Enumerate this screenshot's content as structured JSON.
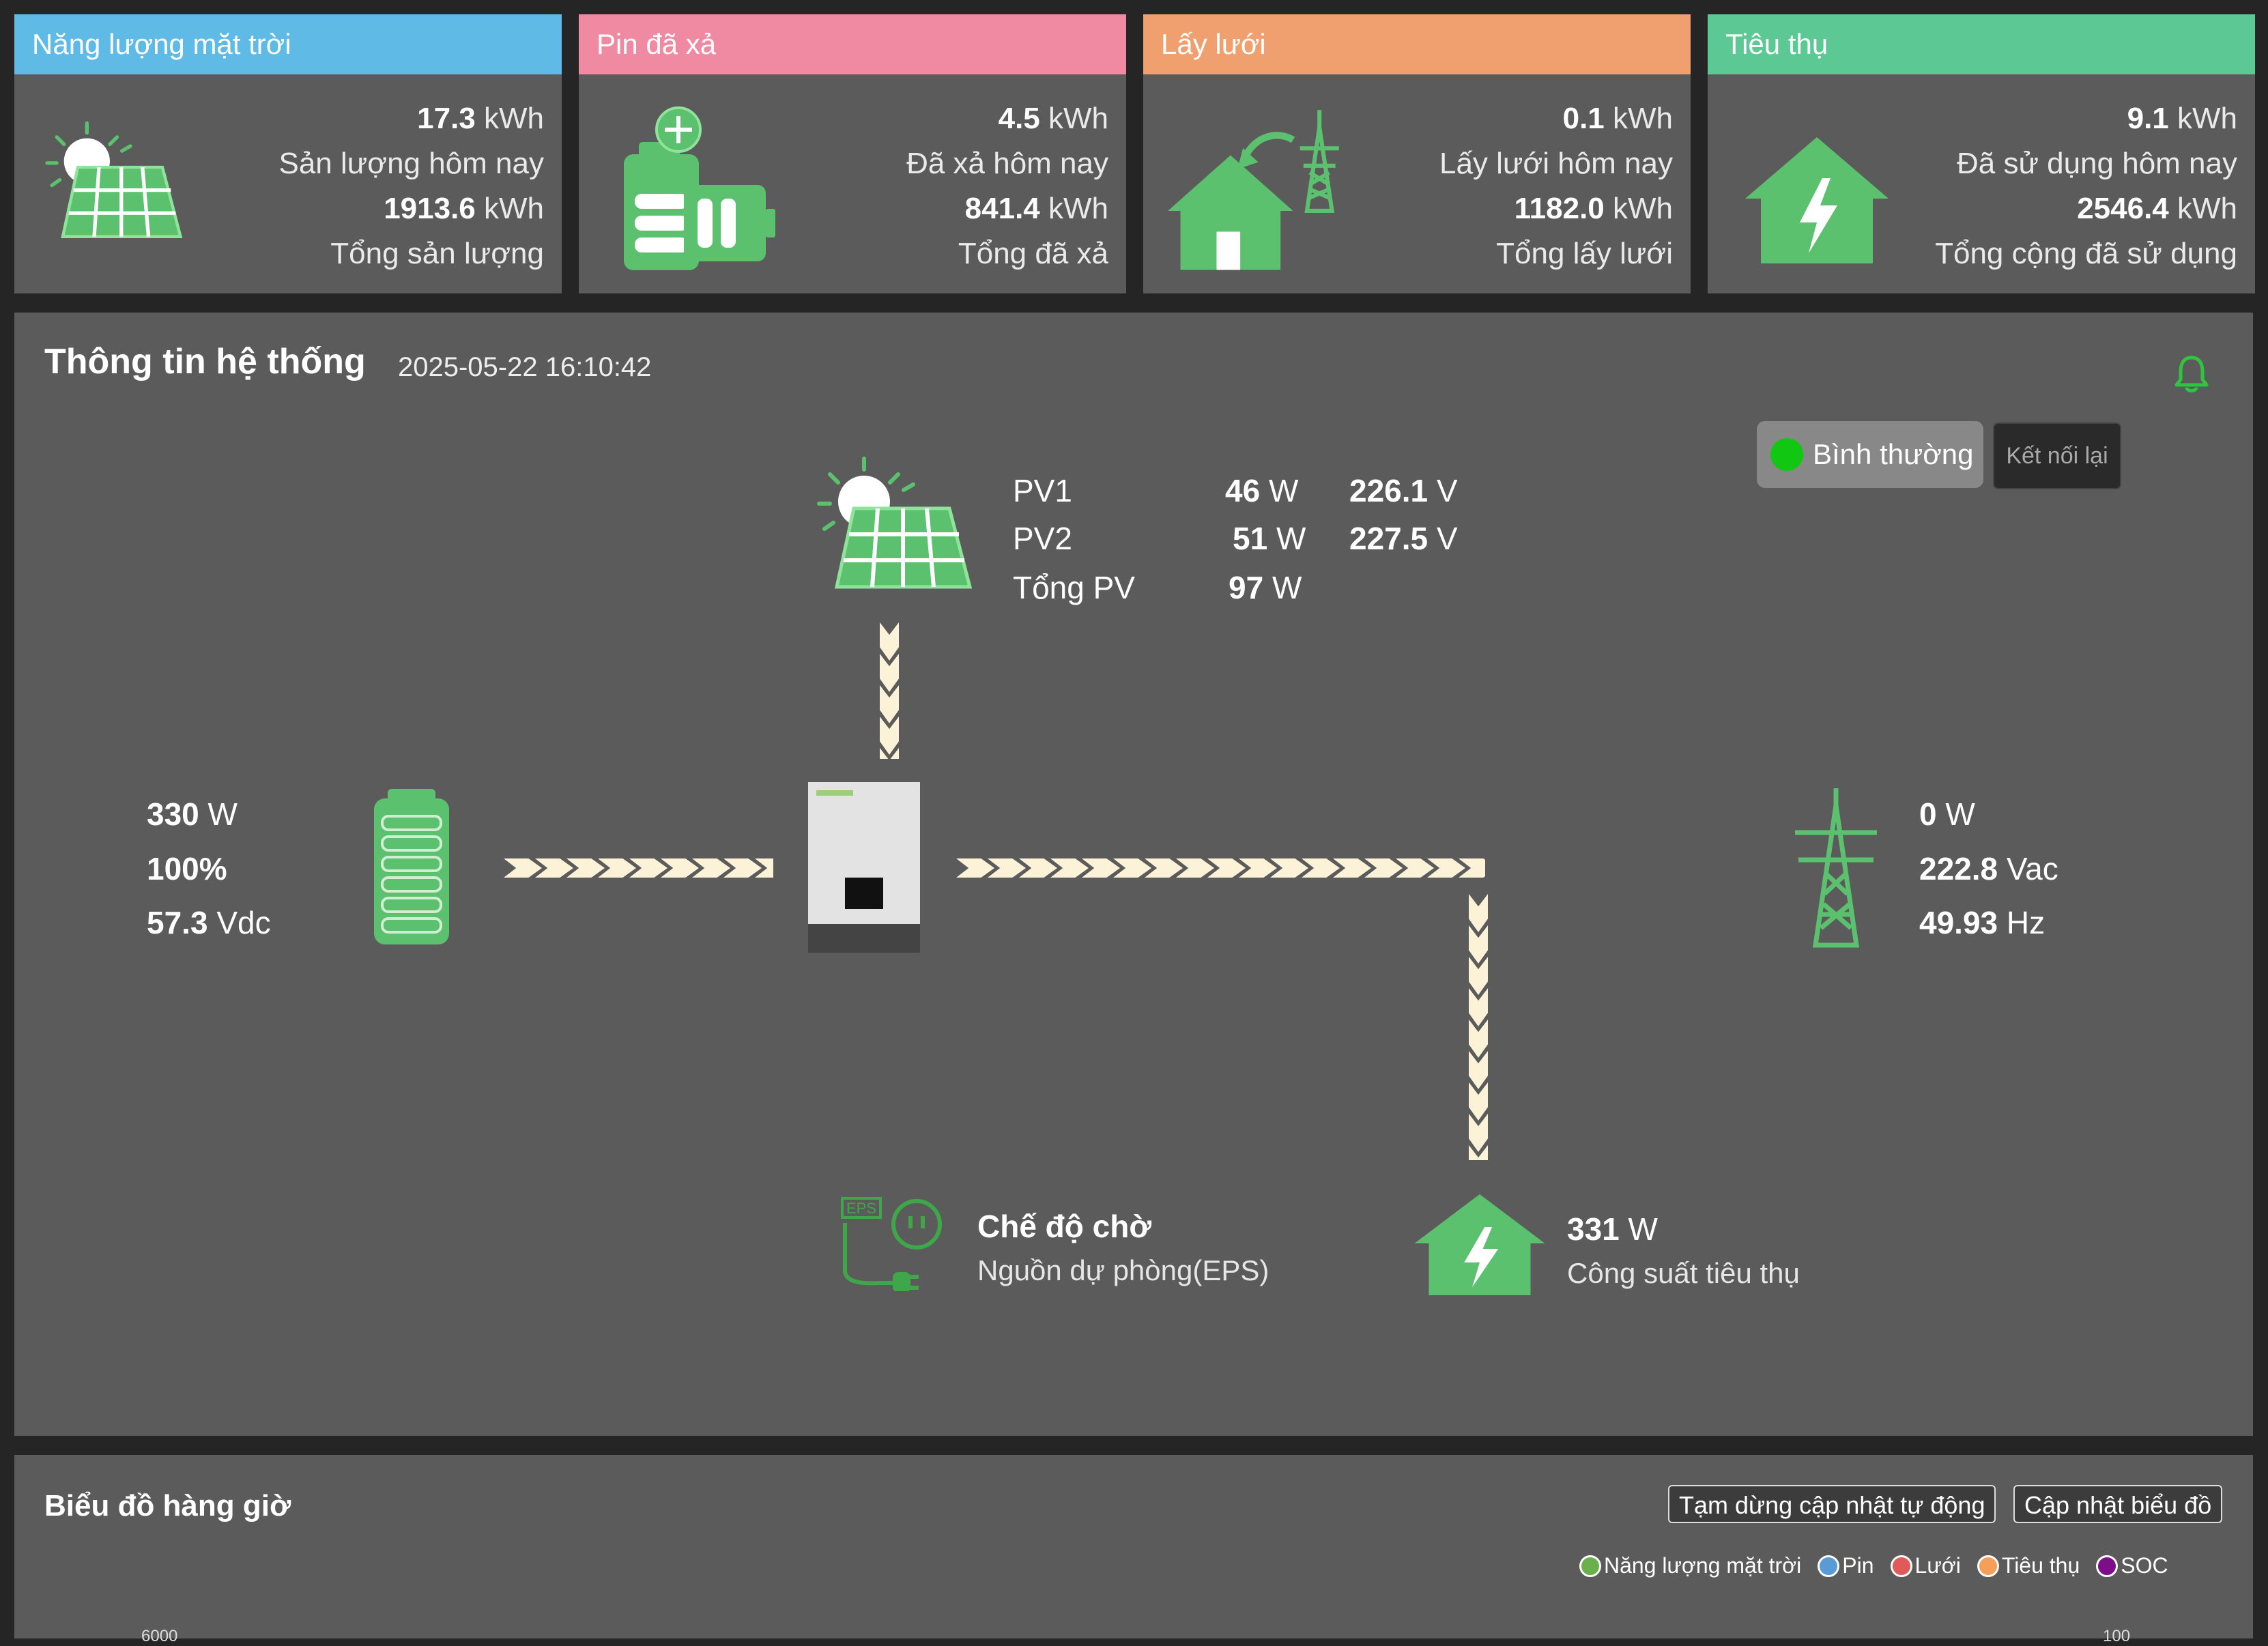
{
  "cards": [
    {
      "title": "Năng lượng mặt trời",
      "color": "#5fbbe6",
      "icon": "solar-panel-icon",
      "today_value": "17.3",
      "today_unit": "kWh",
      "today_label": "Sản lượng hôm nay",
      "total_value": "1913.6",
      "total_unit": "kWh",
      "total_label": "Tổng sản lượng"
    },
    {
      "title": "Pin đã xả",
      "color": "#f08aa2",
      "icon": "battery-charge-icon",
      "today_value": "4.5",
      "today_unit": "kWh",
      "today_label": "Đã xả hôm nay",
      "total_value": "841.4",
      "total_unit": "kWh",
      "total_label": "Tổng đã xả"
    },
    {
      "title": "Lấy lưới",
      "color": "#f0a06e",
      "icon": "house-grid-icon",
      "today_value": "0.1",
      "today_unit": "kWh",
      "today_label": "Lấy lưới hôm nay",
      "total_value": "1182.0",
      "total_unit": "kWh",
      "total_label": "Tổng lấy lưới"
    },
    {
      "title": "Tiêu thụ",
      "color": "#5cc894",
      "icon": "house-lightning-icon",
      "today_value": "9.1",
      "today_unit": "kWh",
      "today_label": "Đã sử dụng hôm nay",
      "total_value": "2546.4",
      "total_unit": "kWh",
      "total_label": "Tổng cộng đã sử dụng"
    }
  ],
  "system": {
    "title": "Thông tin hệ thống",
    "timestamp": "2025-05-22 16:10:42",
    "status_label": "Bình thường",
    "reconnect_label": "Kết nối lại",
    "pv": {
      "pv1_label": "PV1",
      "pv1_power": "46",
      "pv1_voltage": "226.1",
      "pv2_label": "PV2",
      "pv2_power": "51",
      "pv2_voltage": "227.5",
      "total_label": "Tổng PV",
      "total_power": "97",
      "power_unit": "W",
      "voltage_unit": "V"
    },
    "battery": {
      "power": "330",
      "power_unit": "W",
      "soc": "100%",
      "voltage": "57.3",
      "voltage_unit": "Vdc"
    },
    "grid": {
      "power": "0",
      "power_unit": "W",
      "voltage": "222.8",
      "voltage_unit": "Vac",
      "frequency": "49.93",
      "frequency_unit": "Hz"
    },
    "eps": {
      "title": "Chế độ chờ",
      "subtitle": "Nguồn dự phòng(EPS)",
      "badge": "EPS"
    },
    "load": {
      "power": "331",
      "power_unit": "W",
      "label": "Công suất tiêu thụ"
    }
  },
  "hourly_chart": {
    "title": "Biểu đồ hàng giờ",
    "pause_button": "Tạm dừng cập nhật tự động",
    "refresh_button": "Cập nhật biểu đồ",
    "legend": [
      {
        "label": "Năng lượng mặt trời",
        "color": "#6ab04c"
      },
      {
        "label": "Pin",
        "color": "#5b9bd5"
      },
      {
        "label": "Lưới",
        "color": "#e05a5a"
      },
      {
        "label": "Tiêu thụ",
        "color": "#f5a05a"
      },
      {
        "label": "SOC",
        "color": "#7d0e8a"
      }
    ],
    "y_left_top": "6000",
    "y_right_top": "100"
  }
}
